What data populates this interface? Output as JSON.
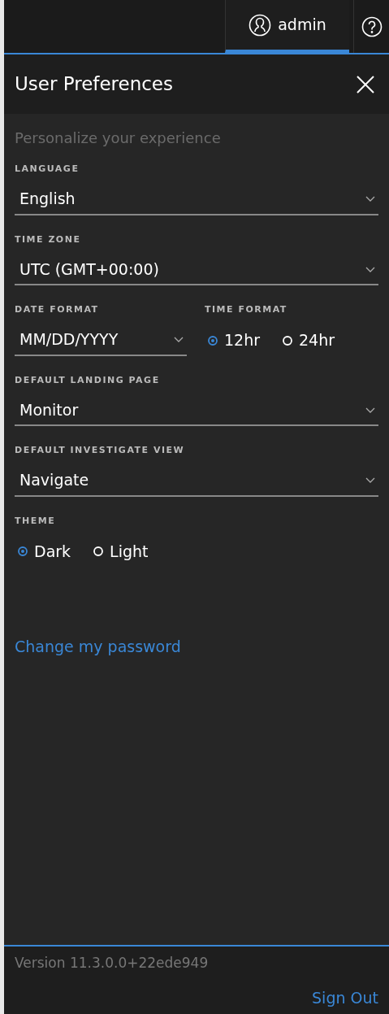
{
  "top_bar": {
    "user_tab": {
      "label": "admin",
      "selected": true
    }
  },
  "panel": {
    "title": "User Preferences",
    "subtitle": "Personalize your experience",
    "rows": [
      [
        {
          "kind": "select",
          "label": "LANGUAGE",
          "value": "English"
        }
      ],
      [
        {
          "kind": "select",
          "label": "TIME ZONE",
          "value": "UTC (GMT+00:00)"
        }
      ],
      [
        {
          "kind": "select",
          "label": "DATE FORMAT",
          "value": "MM/DD/YYYY"
        },
        {
          "kind": "radio",
          "label": "TIME FORMAT",
          "options": [
            {
              "label": "12hr",
              "selected": true
            },
            {
              "label": "24hr",
              "selected": false
            }
          ]
        }
      ],
      [
        {
          "kind": "select",
          "label": "DEFAULT LANDING PAGE",
          "value": "Monitor"
        }
      ],
      [
        {
          "kind": "select",
          "label": "DEFAULT INVESTIGATE VIEW",
          "value": "Navigate"
        }
      ],
      [
        {
          "kind": "radio",
          "label": "THEME",
          "options": [
            {
              "label": "Dark",
              "selected": true
            },
            {
              "label": "Light",
              "selected": false
            }
          ]
        }
      ]
    ],
    "link": "Change my password"
  },
  "footer": {
    "version": "Version 11.3.0.0+22ede949",
    "sign_out": "Sign Out"
  }
}
